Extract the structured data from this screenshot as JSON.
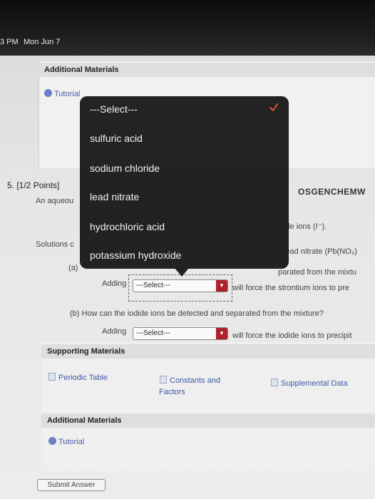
{
  "status": {
    "time": "3 PM",
    "date": "Mon Jun 7"
  },
  "top_panel": {
    "header": "Additional Materials",
    "tutorial_link": "Tutorial"
  },
  "question": {
    "number": "5.  [1/2 Points]",
    "course_code": "OSGENCHEMW",
    "intro_left": "An aqueou",
    "intro_right": "ide ions (I⁻).",
    "solutions_left": "Solutions c",
    "solutions_right": "lead nitrate (Pb(NO₃)",
    "part_a_label": "(a)",
    "part_a_right": "parated from the mixtu",
    "part_a_adding": "Adding",
    "part_a_select_value": "---Select---",
    "part_a_suffix": "will force the strontium ions to pre",
    "part_b_question": "(b)  How can the iodide ions be detected and separated from the mixture?",
    "part_b_adding": "Adding",
    "part_b_select_value": "---Select---",
    "part_b_suffix": "will force the iodide ions to precipit"
  },
  "bottom_panel": {
    "supporting_header": "Supporting Materials",
    "periodic_table": "Periodic Table",
    "constants_line1": "Constants and",
    "constants_line2": "Factors",
    "supplemental": "Supplemental Data",
    "additional_header": "Additional Materials",
    "tutorial_link": "Tutorial"
  },
  "submit_label": "Submit Answer",
  "dropdown": {
    "options": [
      "---Select---",
      "sulfuric acid",
      "sodium chloride",
      "lead nitrate",
      "hydrochloric acid",
      "potassium hydroxide"
    ],
    "selected_index": 0
  },
  "colors": {
    "accent": "#b0202a",
    "link": "#4a5fa8",
    "check": "#e0523a"
  }
}
